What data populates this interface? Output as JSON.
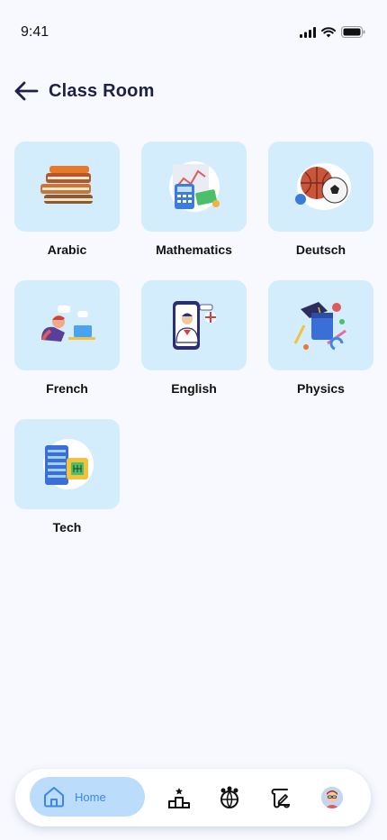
{
  "status_bar": {
    "time": "9:41"
  },
  "header": {
    "title": "Class Room",
    "back_icon": "arrow-left-icon"
  },
  "subjects": [
    {
      "label": "Arabic",
      "icon": "books-icon"
    },
    {
      "label": "Mathematics",
      "icon": "calculator-chart-icon"
    },
    {
      "label": "Deutsch",
      "icon": "sports-balls-icon"
    },
    {
      "label": "French",
      "icon": "student-laptop-icon"
    },
    {
      "label": "English",
      "icon": "teacher-phone-icon"
    },
    {
      "label": "Physics",
      "icon": "science-items-icon"
    },
    {
      "label": "Tech",
      "icon": "server-chip-icon"
    }
  ],
  "bottom_nav": {
    "home_label": "Home",
    "items": [
      "home-icon",
      "podium-icon",
      "community-globe-icon",
      "scroll-edit-icon",
      "profile-avatar"
    ]
  },
  "colors": {
    "background": "#f7f9fe",
    "tile": "#d3edfc",
    "home_pill": "#bcdcfb",
    "home_text": "#3b86e6",
    "title": "#1e2145"
  }
}
